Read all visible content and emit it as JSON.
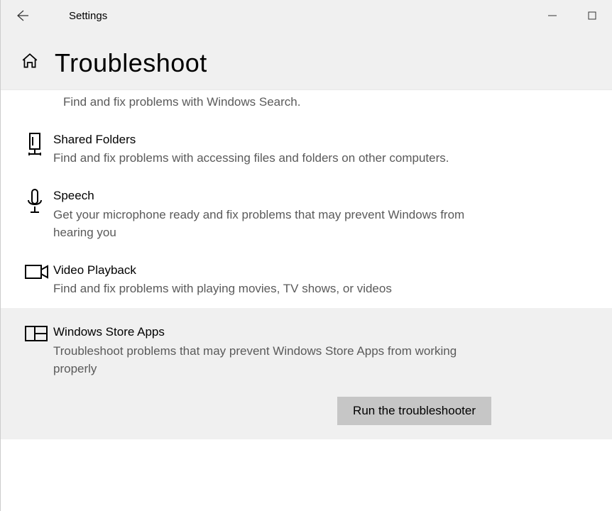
{
  "app_title": "Settings",
  "page_title": "Troubleshoot",
  "items": [
    {
      "title": "",
      "desc": "Find and fix problems with Windows Search."
    },
    {
      "title": "Shared Folders",
      "desc": "Find and fix problems with accessing files and folders on other computers."
    },
    {
      "title": "Speech",
      "desc": "Get your microphone ready and fix problems that may prevent Windows from hearing you"
    },
    {
      "title": "Video Playback",
      "desc": "Find and fix problems with playing movies, TV shows, or videos"
    },
    {
      "title": "Windows Store Apps",
      "desc": "Troubleshoot problems that may prevent Windows Store Apps from working properly"
    }
  ],
  "run_button": "Run the troubleshooter"
}
